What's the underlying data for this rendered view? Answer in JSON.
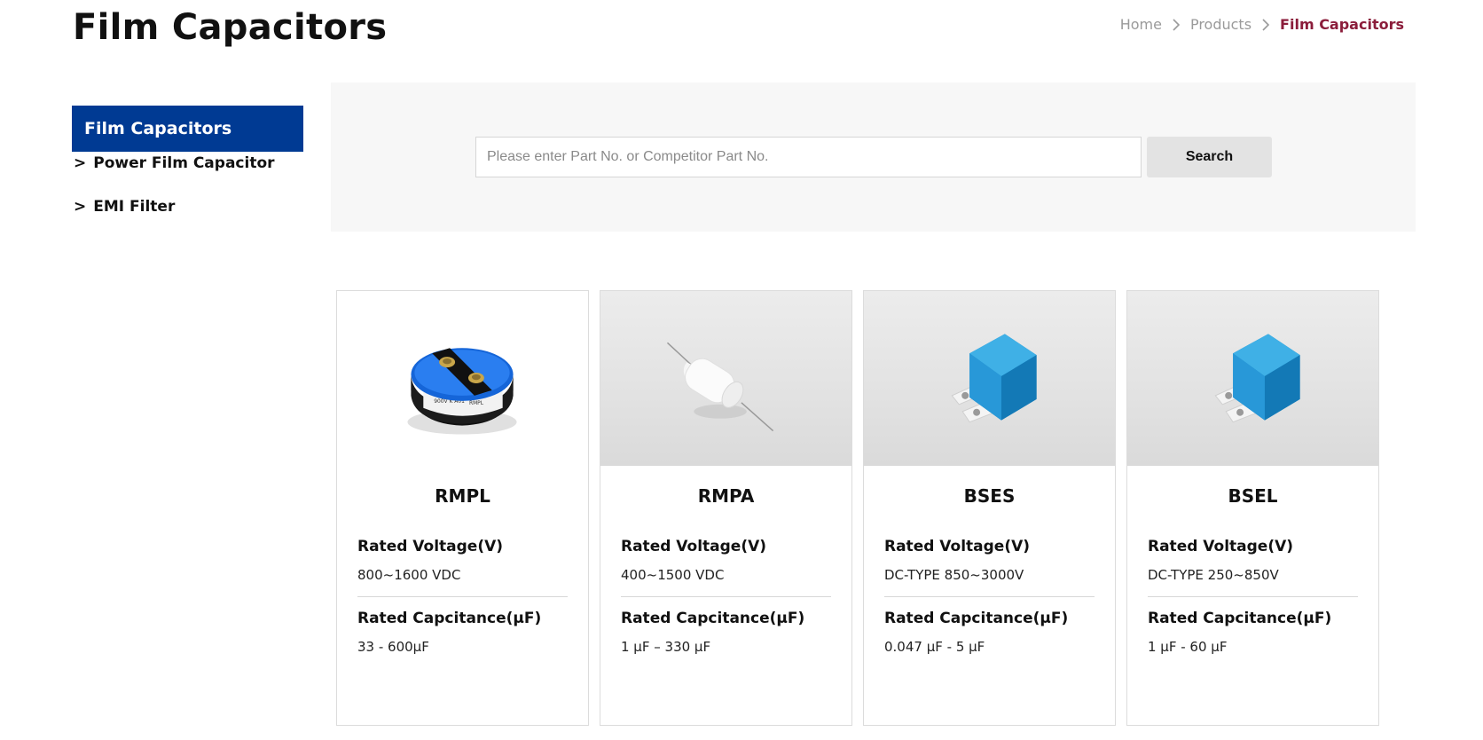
{
  "header": {
    "title": "Film Capacitors",
    "breadcrumb": [
      "Home",
      "Products",
      "Film Capacitors"
    ]
  },
  "sidebar": {
    "heading": "Film Capacitors",
    "items": [
      {
        "prefix": ">",
        "label": "Power Film Capacitor"
      },
      {
        "prefix": ">",
        "label": "EMI Filter"
      }
    ]
  },
  "search": {
    "placeholder": "Please enter Part No. or Competitor Part No.",
    "value": "",
    "button_label": "Search"
  },
  "products": [
    {
      "name": "RMPL",
      "voltage_label": "Rated Voltage(V)",
      "voltage": "800~1600 VDC",
      "capacitance_label": "Rated Capcitance(μF)",
      "capacitance": "33 - 600μF",
      "image_icon": "round-blue-capacitor"
    },
    {
      "name": "RMPA",
      "voltage_label": "Rated Voltage(V)",
      "voltage": "400~1500 VDC",
      "capacitance_label": "Rated Capcitance(μF)",
      "capacitance": "1 μF – 330 μF",
      "image_icon": "axial-white-capacitor"
    },
    {
      "name": "BSES",
      "voltage_label": "Rated Voltage(V)",
      "voltage": "DC-TYPE 850~3000V",
      "capacitance_label": "Rated Capcitance(μF)",
      "capacitance": "0.047 μF - 5 μF",
      "image_icon": "box-blue-capacitor"
    },
    {
      "name": "BSEL",
      "voltage_label": "Rated Voltage(V)",
      "voltage": "DC-TYPE 250~850V",
      "capacitance_label": "Rated Capcitance(μF)",
      "capacitance": "1 μF - 60 μF",
      "image_icon": "box-blue-capacitor"
    }
  ],
  "colors": {
    "sidebar_active_bg": "#003a93",
    "breadcrumb_active": "#8b1d3b",
    "search_panel_bg": "#f7f7f7",
    "capacitor_blue": "#1f8fd0"
  }
}
